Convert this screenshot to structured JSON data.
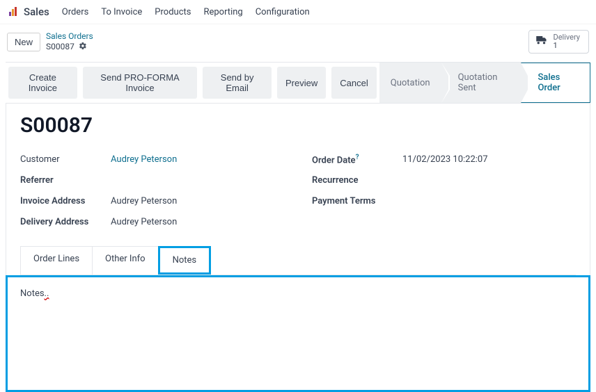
{
  "nav": {
    "brand": "Sales",
    "items": [
      "Orders",
      "To Invoice",
      "Products",
      "Reporting",
      "Configuration"
    ]
  },
  "subheader": {
    "new_label": "New",
    "breadcrumb_parent": "Sales Orders",
    "breadcrumb_current": "S00087",
    "delivery_label": "Delivery",
    "delivery_count": "1"
  },
  "actions": {
    "create_invoice": "Create Invoice",
    "send_proforma": "Send PRO-FORMA Invoice",
    "send_email": "Send by Email",
    "preview": "Preview",
    "cancel": "Cancel"
  },
  "stages": {
    "quotation": "Quotation",
    "quotation_sent": "Quotation Sent",
    "sales_order": "Sales Order"
  },
  "record": {
    "name": "S00087",
    "labels": {
      "customer": "Customer",
      "referrer": "Referrer",
      "invoice_address": "Invoice Address",
      "delivery_address": "Delivery Address",
      "order_date": "Order Date",
      "recurrence": "Recurrence",
      "payment_terms": "Payment Terms"
    },
    "values": {
      "customer": "Audrey Peterson",
      "referrer": "",
      "invoice_address": "Audrey Peterson",
      "delivery_address": "Audrey Peterson",
      "order_date": "11/02/2023 10:22:07",
      "recurrence": "",
      "payment_terms": ""
    }
  },
  "tabs": {
    "order_lines": "Order Lines",
    "other_info": "Other Info",
    "notes": "Notes"
  },
  "notes": {
    "content_plain": "Notes..",
    "content_main": "Notes",
    "content_squiggle": ".."
  }
}
